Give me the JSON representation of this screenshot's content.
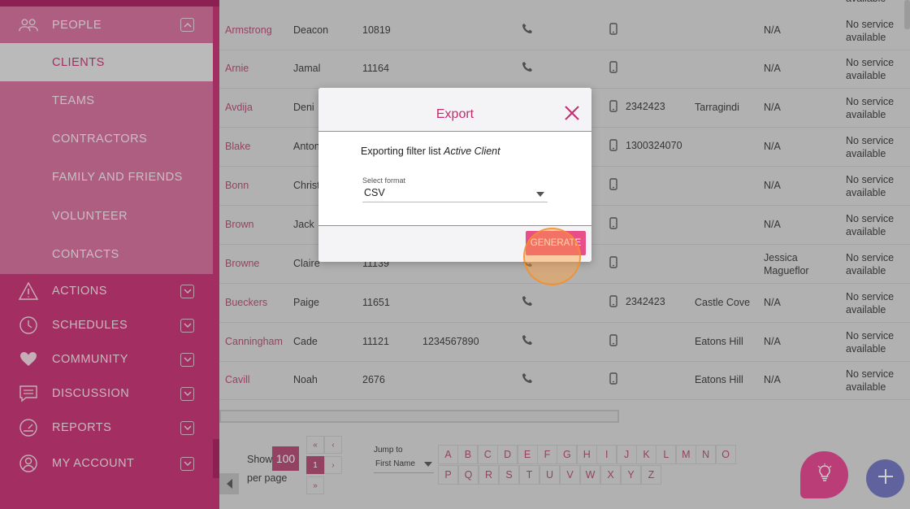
{
  "sidebar": {
    "people": "PEOPLE",
    "sub": [
      "CLIENTS",
      "TEAMS",
      "CONTRACTORS",
      "FAMILY AND FRIENDS",
      "VOLUNTEER",
      "CONTACTS"
    ],
    "sections": [
      "ACTIONS",
      "SCHEDULES",
      "COMMUNITY",
      "DISCUSSION",
      "REPORTS",
      "MY ACCOUNT"
    ]
  },
  "table": {
    "top_partial": "available",
    "rows": [
      {
        "last": "Armstrong",
        "first": "Deacon",
        "id": "10819",
        "phone": "",
        "mobile": "",
        "suburb": "",
        "na": "N/A",
        "svc1": "No service",
        "svc2": "available"
      },
      {
        "last": "Arnie",
        "first": "Jamal",
        "id": "11164",
        "phone": "",
        "mobile": "",
        "suburb": "",
        "na": "N/A",
        "svc1": "No service",
        "svc2": "available"
      },
      {
        "last": "Avdija",
        "first": "Deni",
        "id": "",
        "phone": "",
        "mobile": "2342423",
        "suburb": "Tarragindi",
        "na": "N/A",
        "svc1": "No service",
        "svc2": "available"
      },
      {
        "last": "Blake",
        "first": "Anton",
        "id": "",
        "phone": "",
        "mobile": "1300324070",
        "suburb": "",
        "na": "N/A",
        "svc1": "No service",
        "svc2": "available"
      },
      {
        "last": "Bonn",
        "first": "Christ",
        "id": "",
        "phone": "",
        "mobile": "",
        "suburb": "",
        "na": "N/A",
        "svc1": "No service",
        "svc2": "available"
      },
      {
        "last": "Brown",
        "first": "Jack",
        "id": "",
        "phone": "",
        "mobile": "",
        "suburb": "",
        "na": "N/A",
        "svc1": "No service",
        "svc2": "available"
      },
      {
        "last": "Browne",
        "first": "Claire",
        "id": "11139",
        "phone": "",
        "mobile": "",
        "suburb": "",
        "na": "Jessica",
        "na2": "Magueflor",
        "svc1": "No service",
        "svc2": "available"
      },
      {
        "last": "Bueckers",
        "first": "Paige",
        "id": "11651",
        "phone": "",
        "mobile": "2342423",
        "suburb": "Castle Cove",
        "na": "N/A",
        "svc1": "No service",
        "svc2": "available"
      },
      {
        "last": "Canningham",
        "first": "Cade",
        "id": "11121",
        "phone": "1234567890",
        "mobile": "",
        "suburb": "Eatons Hill",
        "na": "N/A",
        "svc1": "No service",
        "svc2": "available"
      },
      {
        "last": "Cavill",
        "first": "Noah",
        "id": "2676",
        "phone": "",
        "mobile": "",
        "suburb": "Eatons Hill",
        "na": "N/A",
        "svc1": "No service",
        "svc2": "available"
      }
    ]
  },
  "pagination": {
    "show": "Show",
    "per_page_value": "100",
    "per_page": "per page",
    "first": "«",
    "prev": "‹",
    "current": "1",
    "next": "›",
    "last": "»",
    "jump_to": "Jump to",
    "jump_field": "First Name",
    "letters_row1": [
      "A",
      "B",
      "C",
      "D",
      "E",
      "F",
      "G",
      "H",
      "I",
      "J",
      "K",
      "L",
      "M",
      "N",
      "O"
    ],
    "letters_row2": [
      "P",
      "Q",
      "R",
      "S",
      "T",
      "U",
      "V",
      "W",
      "X",
      "Y",
      "Z"
    ]
  },
  "modal": {
    "title": "Export",
    "text_prefix": "Exporting filter list ",
    "text_list": "Active Client",
    "format_label": "Select format",
    "format_value": "CSV",
    "generate": "GENERATE"
  },
  "colors": {
    "primary": "#c62b6f",
    "accent": "#e84f88",
    "add_fab": "#6b6fbd"
  }
}
